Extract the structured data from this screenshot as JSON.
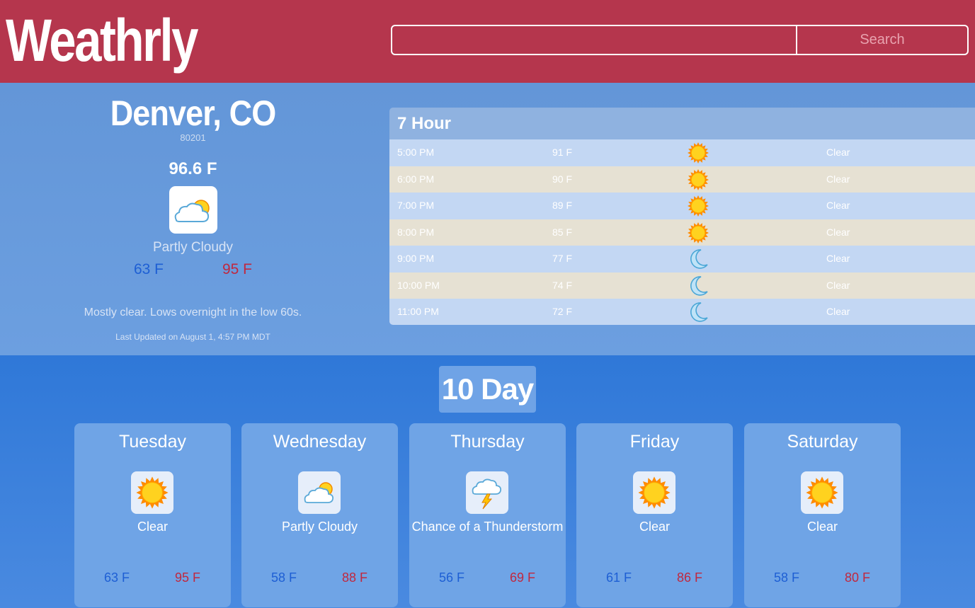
{
  "header": {
    "logo": "Weathrly",
    "search_placeholder": "",
    "search_label": "Search"
  },
  "current": {
    "city": "Denver, CO",
    "zip": "80201",
    "temp": "96.6 F",
    "icon": "partly-cloudy-icon",
    "condition": "Partly Cloudy",
    "low": "63 F",
    "high": "95 F",
    "summary": "Mostly clear. Lows overnight in the low 60s.",
    "updated": "Last Updated on August 1, 4:57 PM MDT"
  },
  "hourly": {
    "title": "7 Hour",
    "rows": [
      {
        "time": "5:00 PM",
        "temp": "91 F",
        "icon": "sun-icon",
        "condition": "Clear"
      },
      {
        "time": "6:00 PM",
        "temp": "90 F",
        "icon": "sun-icon",
        "condition": "Clear"
      },
      {
        "time": "7:00 PM",
        "temp": "89 F",
        "icon": "sun-icon",
        "condition": "Clear"
      },
      {
        "time": "8:00 PM",
        "temp": "85 F",
        "icon": "sun-icon",
        "condition": "Clear"
      },
      {
        "time": "9:00 PM",
        "temp": "77 F",
        "icon": "moon-icon",
        "condition": "Clear"
      },
      {
        "time": "10:00 PM",
        "temp": "74 F",
        "icon": "moon-icon",
        "condition": "Clear"
      },
      {
        "time": "11:00 PM",
        "temp": "72 F",
        "icon": "moon-icon",
        "condition": "Clear"
      }
    ]
  },
  "tenday": {
    "title": "10 Day",
    "days": [
      {
        "name": "Tuesday",
        "icon": "sun-icon",
        "condition": "Clear",
        "low": "63 F",
        "high": "95 F"
      },
      {
        "name": "Wednesday",
        "icon": "partly-cloudy-icon",
        "condition": "Partly Cloudy",
        "low": "58 F",
        "high": "88 F"
      },
      {
        "name": "Thursday",
        "icon": "thunderstorm-icon",
        "condition": "Chance of a Thunderstorm",
        "low": "56 F",
        "high": "69 F"
      },
      {
        "name": "Friday",
        "icon": "sun-icon",
        "condition": "Clear",
        "low": "61 F",
        "high": "86 F"
      },
      {
        "name": "Saturday",
        "icon": "sun-icon",
        "condition": "Clear",
        "low": "58 F",
        "high": "80 F"
      }
    ]
  },
  "colors": {
    "header_bg": "#b5364d",
    "low_temp": "#1e5fd4",
    "high_temp": "#c0283f"
  }
}
